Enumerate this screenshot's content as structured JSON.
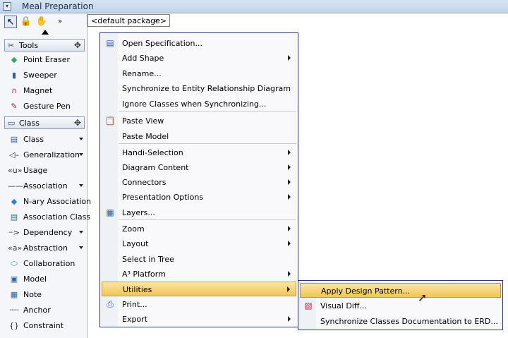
{
  "window": {
    "title": "Meal Preparation"
  },
  "breadcrumb": {
    "package": "<default package>"
  },
  "palette": {
    "groups": [
      {
        "label": "Tools",
        "icon": "tools-icon",
        "items": [
          {
            "label": "Point Eraser",
            "icon": "eraser-icon",
            "color": "#3aa65a"
          },
          {
            "label": "Sweeper",
            "icon": "sweeper-icon",
            "color": "#2f5fa8"
          },
          {
            "label": "Magnet",
            "icon": "magnet-icon",
            "color": "#c9283a"
          },
          {
            "label": "Gesture Pen",
            "icon": "pen-icon",
            "color": "#8a2a2a"
          }
        ]
      },
      {
        "label": "Class",
        "icon": "class-group-icon",
        "items": [
          {
            "label": "Class",
            "icon": "class-icon",
            "color": "#2f5fa8",
            "dropdown": true
          },
          {
            "label": "Generalization",
            "icon": "generalization-icon",
            "color": "#333333",
            "dropdown": true
          },
          {
            "label": "Usage",
            "icon": "usage-icon",
            "color": "#333333"
          },
          {
            "label": "Association",
            "icon": "association-icon",
            "color": "#333333",
            "dropdown": true
          },
          {
            "label": "N-ary Association",
            "icon": "nary-association-icon",
            "color": "#2f7fd6"
          },
          {
            "label": "Association Class",
            "icon": "association-class-icon",
            "color": "#2f5fa8"
          },
          {
            "label": "Dependency",
            "icon": "dependency-icon",
            "color": "#333333",
            "dropdown": true
          },
          {
            "label": "Abstraction",
            "icon": "abstraction-icon",
            "color": "#333333",
            "dropdown": true
          },
          {
            "label": "Collaboration",
            "icon": "collaboration-icon",
            "color": "#2f7fd6"
          },
          {
            "label": "Model",
            "icon": "model-icon",
            "color": "#2f5fa8"
          },
          {
            "label": "Note",
            "icon": "note-icon",
            "color": "#2f5fa8"
          },
          {
            "label": "Anchor",
            "icon": "anchor-icon",
            "color": "#333333"
          },
          {
            "label": "Constraint",
            "icon": "constraint-icon",
            "color": "#333333"
          }
        ]
      }
    ]
  },
  "context_menu": {
    "items": [
      {
        "label": "Open Specification...",
        "icon": "specification-icon"
      },
      {
        "label": "Add Shape",
        "submenu": true
      },
      {
        "label": "Rename..."
      },
      {
        "label": "Synchronize to Entity Relationship Diagram"
      },
      {
        "label": "Ignore Classes when Synchronizing..."
      },
      {
        "label": "Paste View",
        "icon": "paste-icon"
      },
      {
        "label": "Paste Model"
      },
      {
        "label": "Handi-Selection",
        "submenu": true
      },
      {
        "label": "Diagram Content",
        "submenu": true
      },
      {
        "label": "Connectors",
        "submenu": true
      },
      {
        "label": "Presentation Options",
        "submenu": true
      },
      {
        "label": "Layers...",
        "icon": "layers-icon"
      },
      {
        "label": "Zoom",
        "submenu": true
      },
      {
        "label": "Layout",
        "submenu": true
      },
      {
        "label": "Select in Tree"
      },
      {
        "label": "A³ Platform",
        "submenu": true
      },
      {
        "label": "Utilities",
        "submenu": true,
        "highlighted": true
      },
      {
        "label": "Print...",
        "icon": "print-icon"
      },
      {
        "label": "Export",
        "submenu": true
      }
    ]
  },
  "utilities_submenu": {
    "items": [
      {
        "label": "Apply Design Pattern...",
        "highlighted": true
      },
      {
        "label": "Visual Diff...",
        "icon": "visual-diff-icon"
      },
      {
        "label": "Synchronize Classes Documentation to ERD..."
      }
    ]
  },
  "colors": {
    "highlight": "#f3c456",
    "menu_border": "#2f3d6e",
    "title_bg": "#c3d4ea"
  }
}
